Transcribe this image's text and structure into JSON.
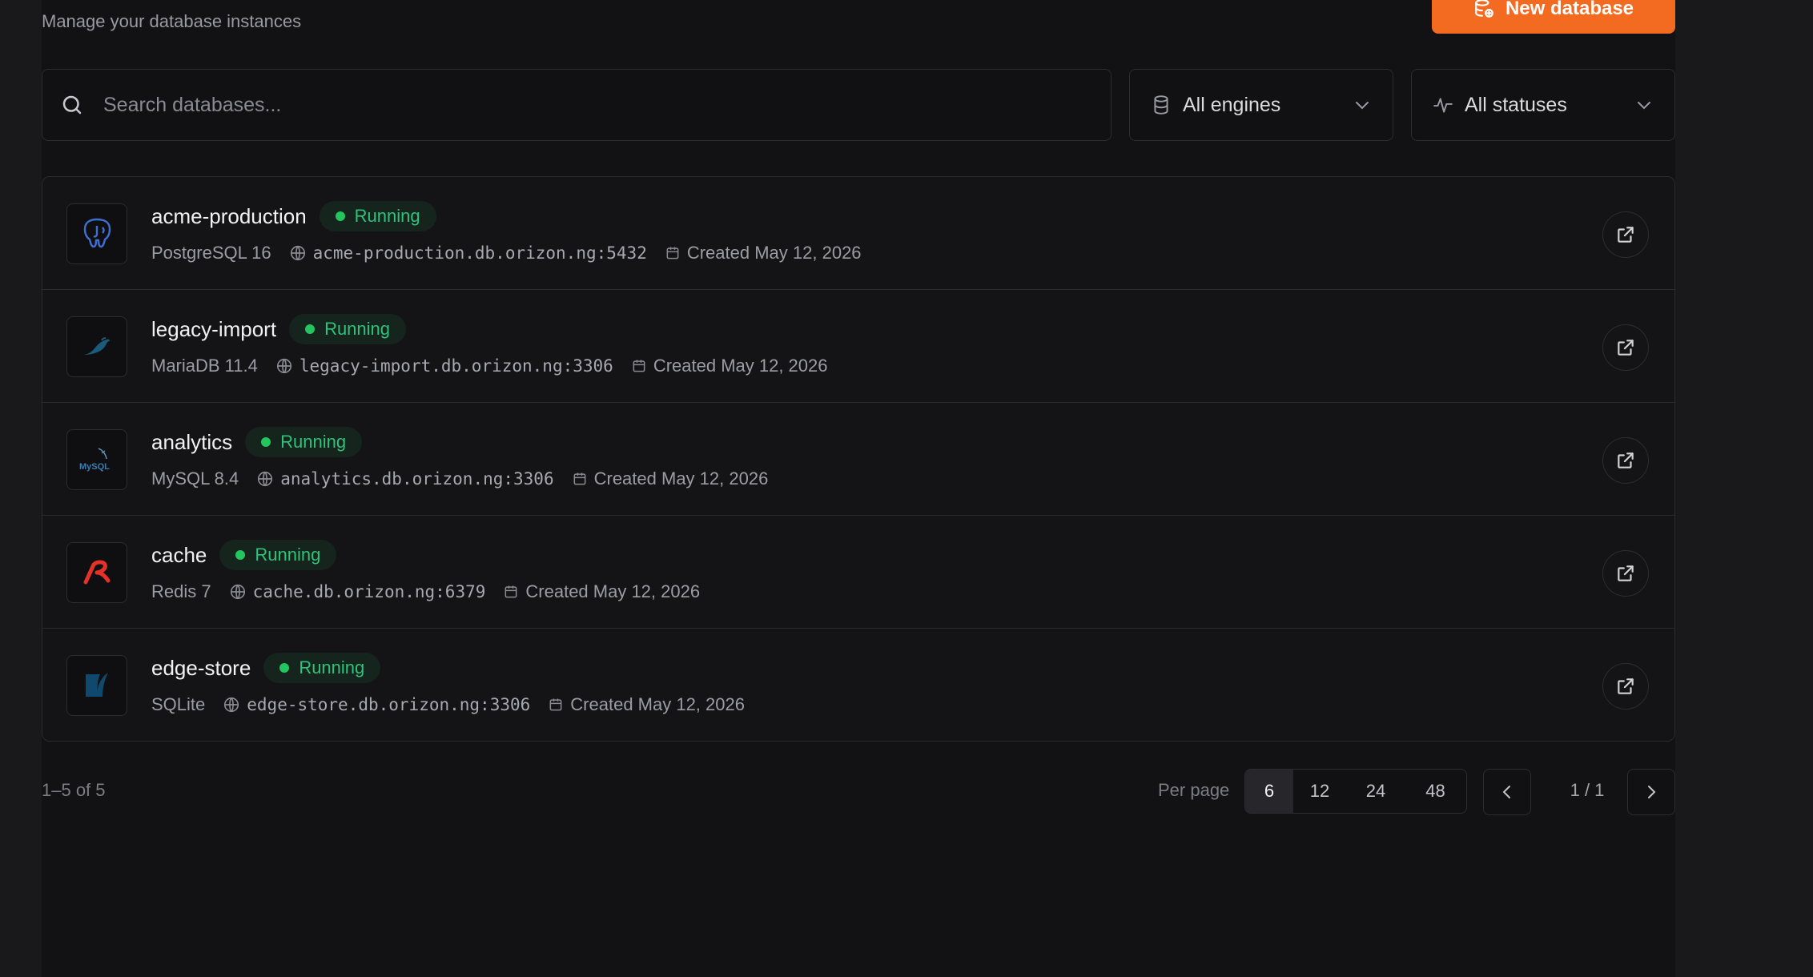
{
  "header": {
    "subtitle": "Manage your database instances",
    "new_button_label": "New database"
  },
  "search": {
    "placeholder": "Search databases..."
  },
  "filters": {
    "engine": {
      "selected": "All engines"
    },
    "status": {
      "selected": "All statuses"
    }
  },
  "databases": [
    {
      "name": "acme-production",
      "status": "Running",
      "engine": "PostgreSQL 16",
      "host": "acme-production.db.orizon.ng:5432",
      "created": "Created May 12, 2026",
      "icon": "postgresql-logo-icon"
    },
    {
      "name": "legacy-import",
      "status": "Running",
      "engine": "MariaDB 11.4",
      "host": "legacy-import.db.orizon.ng:3306",
      "created": "Created May 12, 2026",
      "icon": "mariadb-logo-icon"
    },
    {
      "name": "analytics",
      "status": "Running",
      "engine": "MySQL 8.4",
      "host": "analytics.db.orizon.ng:3306",
      "created": "Created May 12, 2026",
      "icon": "mysql-logo-icon",
      "logo_text": "MySQL"
    },
    {
      "name": "cache",
      "status": "Running",
      "engine": "Redis 7",
      "host": "cache.db.orizon.ng:6379",
      "created": "Created May 12, 2026",
      "icon": "redis-logo-icon"
    },
    {
      "name": "edge-store",
      "status": "Running",
      "engine": "SQLite",
      "host": "edge-store.db.orizon.ng:3306",
      "created": "Created May 12, 2026",
      "icon": "sqlite-logo-icon"
    }
  ],
  "pagination": {
    "range": "1–5 of 5",
    "per_page_label": "Per page",
    "per_page_options": [
      "6",
      "12",
      "24",
      "48"
    ],
    "per_page_selected": "6",
    "page_indicator": "1 / 1"
  },
  "colors": {
    "accent": "#f26b21",
    "running": "#22c55e",
    "background": "#121215"
  }
}
